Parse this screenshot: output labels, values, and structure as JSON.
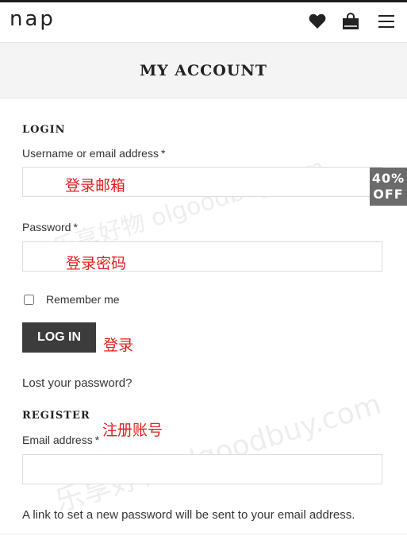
{
  "header": {
    "logo": "nap",
    "icons": {
      "wishlist": "heart-icon",
      "cart": "shopping-bag-icon",
      "menu": "hamburger-menu-icon"
    }
  },
  "page": {
    "title": "MY ACCOUNT"
  },
  "login": {
    "heading": "LOGIN",
    "username_label": "Username or email address",
    "username_value": "",
    "password_label": "Password",
    "password_value": "",
    "required_mark": "*",
    "remember_label": "Remember me",
    "remember_checked": false,
    "button_label": "LOG IN",
    "lost_password": "Lost your password?"
  },
  "register": {
    "heading": "REGISTER",
    "email_label": "Email address",
    "email_value": "",
    "required_mark": "*",
    "hint": "A link to set a new password will be sent to your email address."
  },
  "badge": {
    "line1": "40%",
    "line2": "OFF"
  },
  "annotations": {
    "email": "登录邮箱",
    "password": "登录密码",
    "login": "登录",
    "register": "注册账号"
  },
  "watermark": {
    "text": "乐享好物 olgoodbuy.com"
  },
  "colors": {
    "annotation": "#e02020",
    "button": "#3c3c3c",
    "title_band": "#f4f4f4",
    "badge": "#6b6b6b"
  }
}
